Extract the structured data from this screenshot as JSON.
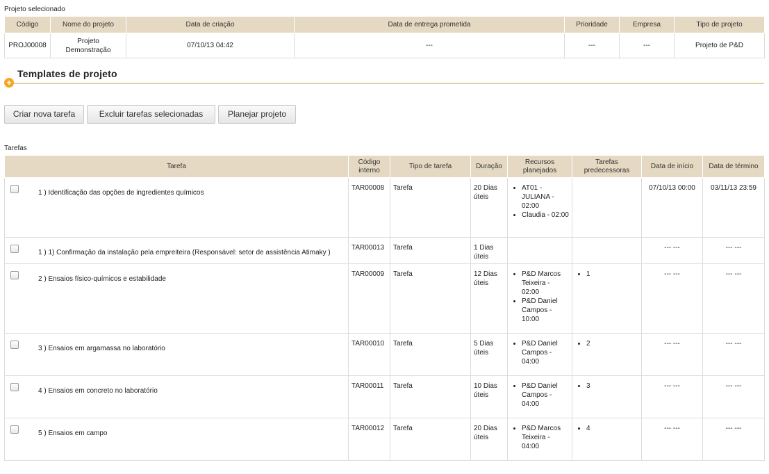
{
  "project_section": {
    "label": "Projeto selecionado",
    "headers": [
      "Código",
      "Nome do projeto",
      "Data de criação",
      "Data de entrega prometida",
      "Prioridade",
      "Empresa",
      "Tipo de projeto"
    ],
    "row": {
      "code": "PROJ00008",
      "name_line1": "Projeto",
      "name_line2": "Demonstração",
      "created": "07/10/13 04:42",
      "promised": "---",
      "priority": "---",
      "company": "---",
      "type": "Projeto de P&D"
    }
  },
  "templates": {
    "title": "Templates de projeto",
    "toggle": "+"
  },
  "buttons": {
    "create": "Criar nova tarefa",
    "delete": "Excluir tarefas selecionadas",
    "plan": "Planejar projeto"
  },
  "tasks_section": {
    "label": "Tarefas",
    "headers": {
      "task": "Tarefa",
      "code_l1": "Código",
      "code_l2": "interno",
      "type": "Tipo de tarefa",
      "duration": "Duração",
      "res_l1": "Recursos",
      "res_l2": "planejados",
      "pred_l1": "Tarefas",
      "pred_l2": "predecessoras",
      "start": "Data de início",
      "end": "Data de término"
    },
    "rows": [
      {
        "name": "1 ) Identificação das opções de ingredientes químicos",
        "code": "TAR00008",
        "type": "Tarefa",
        "duration_l1": "20 Dias",
        "duration_l2": "úteis",
        "resources": [
          "AT01 - JULIANA - 02:00",
          "Claudia - 02:00"
        ],
        "predecessors": [],
        "start": "07/10/13 00:00",
        "end": "03/11/13 23:59"
      },
      {
        "name": "1 ) 1) Confirmação da instalação pela empreiteira (Responsável: setor de assistência Atimaky )",
        "code": "TAR00013",
        "type": "Tarefa",
        "duration_l1": "1 Dias",
        "duration_l2": "úteis",
        "resources": [],
        "predecessors": [],
        "start": "--- ---",
        "end": "--- ---"
      },
      {
        "name": "2 ) Ensaios físico-químicos e estabilidade",
        "code": "TAR00009",
        "type": "Tarefa",
        "duration_l1": "12 Dias",
        "duration_l2": "úteis",
        "resources": [
          "P&D Marcos Teixeira - 02:00",
          "P&D Daniel Campos - 10:00"
        ],
        "predecessors": [
          "1"
        ],
        "start": "--- ---",
        "end": "--- ---"
      },
      {
        "name": "3 ) Ensaios em argamassa no laboratório",
        "code": "TAR00010",
        "type": "Tarefa",
        "duration_l1": "5 Dias",
        "duration_l2": "úteis",
        "resources": [
          "P&D Daniel Campos - 04:00"
        ],
        "predecessors": [
          "2"
        ],
        "start": "--- ---",
        "end": "--- ---"
      },
      {
        "name": "4 ) Ensaios em concreto no laboratório",
        "code": "TAR00011",
        "type": "Tarefa",
        "duration_l1": "10 Dias",
        "duration_l2": "úteis",
        "resources": [
          "P&D Daniel Campos - 04:00"
        ],
        "predecessors": [
          "3"
        ],
        "start": "--- ---",
        "end": "--- ---"
      },
      {
        "name": "5 ) Ensaios em campo",
        "code": "TAR00012",
        "type": "Tarefa",
        "duration_l1": "20 Dias",
        "duration_l2": "úteis",
        "resources": [
          "P&D Marcos Teixeira - 04:00"
        ],
        "predecessors": [
          "4"
        ],
        "start": "--- ---",
        "end": "--- ---"
      }
    ]
  }
}
